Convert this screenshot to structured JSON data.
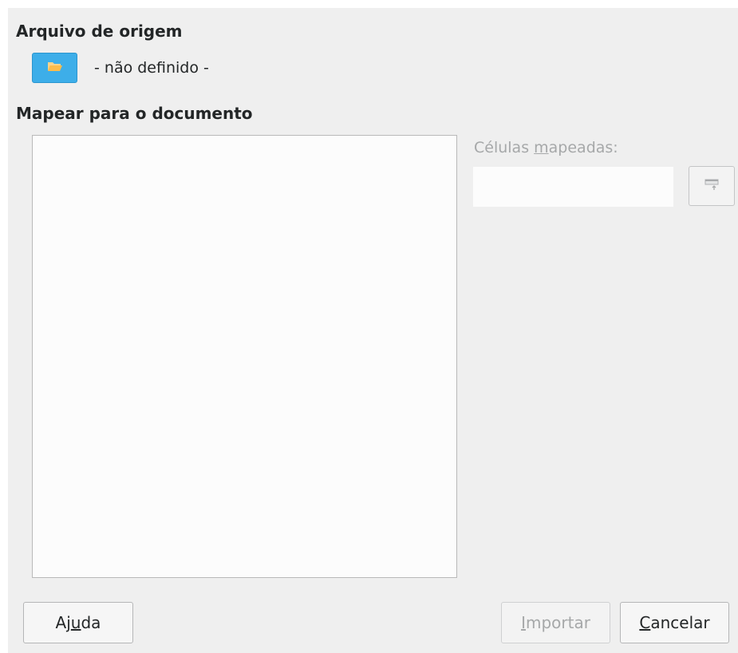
{
  "source": {
    "title": "Arquivo de origem",
    "browse_icon": "folder-open-icon",
    "value": "- não definido -"
  },
  "mapping": {
    "title": "Mapear para o documento",
    "tree_items": []
  },
  "mapped_cells": {
    "label_prefix": "Células ",
    "label_mnemonic": "m",
    "label_rest": "apeadas:",
    "value": "",
    "shrink_icon": "shrink-dialog-icon"
  },
  "buttons": {
    "help_pre": "Aj",
    "help_mnemonic": "u",
    "help_post": "da",
    "import_mnemonic": "I",
    "import_rest": "mportar",
    "cancel_mnemonic": "C",
    "cancel_rest": "ancelar"
  },
  "colors": {
    "accent": "#3daee9",
    "dialog_bg": "#efefef",
    "disabled_text": "#a6a8a9",
    "text": "#232627"
  }
}
